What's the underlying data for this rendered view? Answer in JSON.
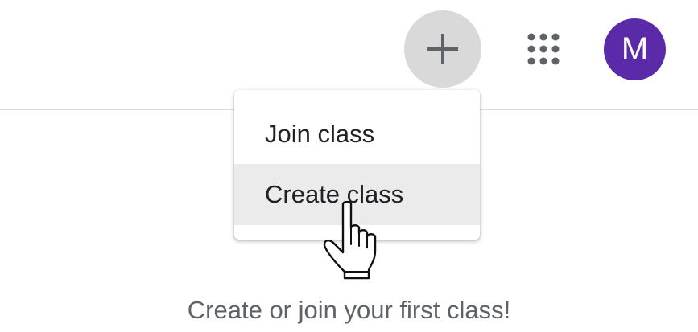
{
  "header": {
    "add_button_icon": "plus-icon",
    "apps_button_icon": "apps-grid-icon",
    "avatar_initial": "M",
    "avatar_color": "#5a2aa8"
  },
  "menu": {
    "items": [
      {
        "label": "Join class",
        "hovered": false
      },
      {
        "label": "Create class",
        "hovered": true
      }
    ]
  },
  "cursor_icon": "hand-pointer-icon",
  "main": {
    "empty_message": "Create or join your first class!"
  },
  "colors": {
    "add_button_bg": "#d9d9d9",
    "icon_gray": "#5f6368",
    "text_primary": "#202124",
    "hover_bg": "#ebebeb",
    "divider": "#dadce0"
  }
}
